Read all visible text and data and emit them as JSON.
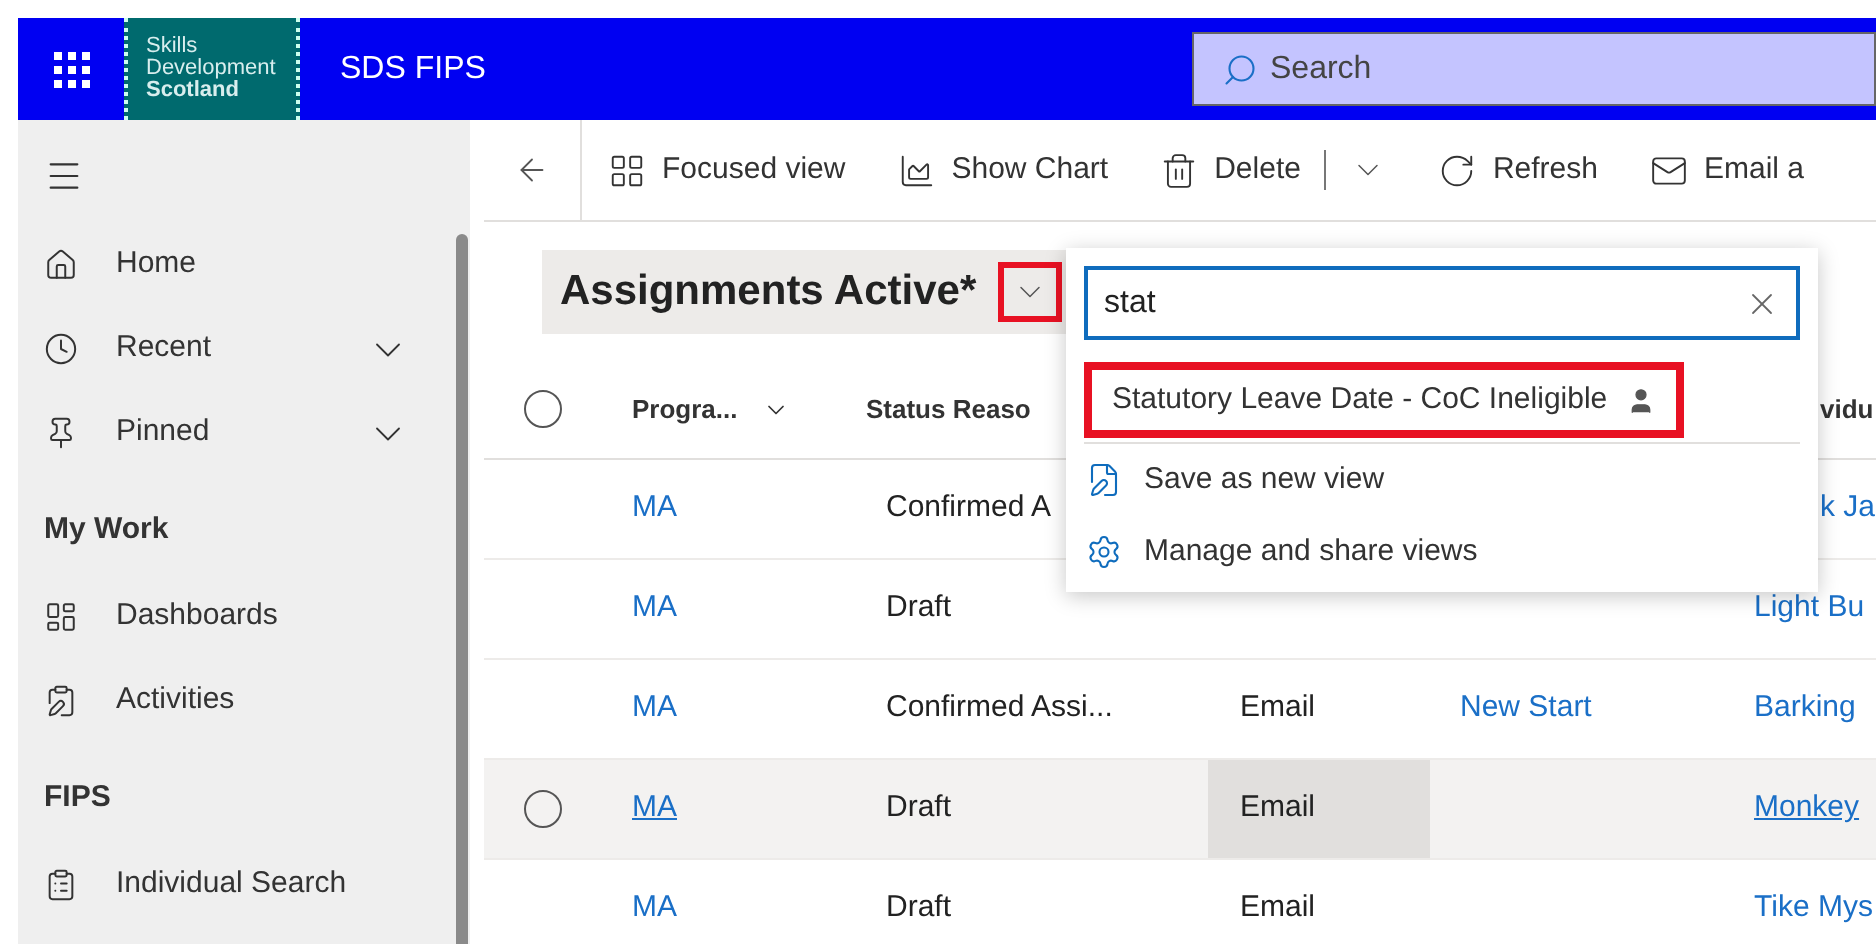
{
  "header": {
    "logo_lines": [
      "Skills",
      "Development",
      "Scotland"
    ],
    "app_title": "SDS FIPS",
    "search": {
      "placeholder": "Search"
    }
  },
  "sidebar": {
    "items": [
      {
        "kind": "link",
        "label": "Home",
        "expandable": false
      },
      {
        "kind": "link",
        "label": "Recent",
        "expandable": true
      },
      {
        "kind": "link",
        "label": "Pinned",
        "expandable": true
      },
      {
        "kind": "heading",
        "label": "My Work"
      },
      {
        "kind": "link",
        "label": "Dashboards",
        "expandable": false
      },
      {
        "kind": "link",
        "label": "Activities",
        "expandable": false
      },
      {
        "kind": "heading",
        "label": "FIPS"
      },
      {
        "kind": "link",
        "label": "Individual Search",
        "expandable": false
      }
    ]
  },
  "command_bar": {
    "items": [
      {
        "kind": "button",
        "label": "Focused view"
      },
      {
        "kind": "button",
        "label": "Show Chart"
      },
      {
        "kind": "split",
        "label": "Delete"
      },
      {
        "kind": "button",
        "label": "Refresh"
      },
      {
        "kind": "button",
        "label": "Email a"
      }
    ]
  },
  "view": {
    "title": "Assignments Active*",
    "chevron_highlighted": true
  },
  "view_menu": {
    "search": {
      "value": "stat"
    },
    "results": [
      {
        "label": "Statutory Leave Date - CoC Ineligible",
        "highlighted": true
      }
    ],
    "actions": [
      "Save as new view",
      "Manage and share views"
    ]
  },
  "table": {
    "all_selected": false,
    "columns": [
      {
        "label": "Progra...",
        "menu": true
      },
      {
        "label": "Status Reaso",
        "menu": false
      },
      {
        "label": "vidu",
        "menu": false
      }
    ],
    "rows": [
      {
        "hovered": false,
        "partly_covered": true,
        "cells": {
          "program": "MA",
          "status": "Confirmed A",
          "column_5": "k Ja"
        }
      },
      {
        "hovered": false,
        "partly_covered": false,
        "cells": {
          "program": "MA",
          "status": "Draft",
          "column_5": "Light Bu"
        }
      },
      {
        "hovered": false,
        "partly_covered": false,
        "cells": {
          "program": "MA",
          "status": "Confirmed Assi...",
          "column_3": "Email",
          "column_4": "New Start",
          "column_5": "Barking"
        }
      },
      {
        "hovered": true,
        "partly_covered": false,
        "cells": {
          "program": "MA",
          "status": "Draft",
          "column_3": "Email",
          "column_5": "Monkey"
        }
      },
      {
        "hovered": false,
        "partly_covered": false,
        "cells": {
          "program": "MA",
          "status": "Draft",
          "column_3": "Email",
          "column_5": "Tike Mys"
        }
      }
    ]
  }
}
